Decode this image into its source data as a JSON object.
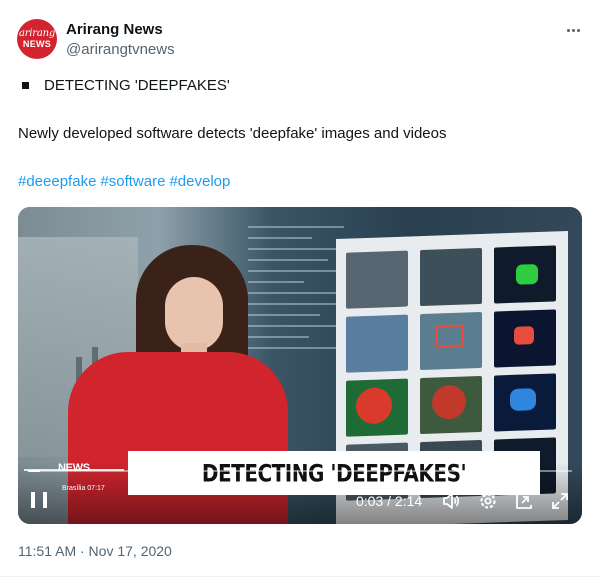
{
  "author": {
    "avatar_line1": "arirang",
    "avatar_line2": "NEWS",
    "name": "Arirang News",
    "handle": "@arirangtvnews"
  },
  "post": {
    "headline": "DETECTING 'DEEPFAKES'",
    "body": "Newly developed software detects 'deepfake' images and videos",
    "hashtags": [
      "#deeepfake",
      "#software",
      "#develop"
    ],
    "timestamp": "11:51 AM · Nov 17, 2020"
  },
  "video": {
    "caption": "DETECTING 'DEEPFAKES'",
    "channel_logo": "NEWS",
    "channel_sub": "Brasília 07:17",
    "current_time": "0:03",
    "duration": "2:14",
    "time_display": "0:03 / 2:14",
    "progress": 0.022
  },
  "icons": {
    "more": "more-icon",
    "bullet": "square-bullet-icon",
    "pause": "pause-icon",
    "volume": "volume-icon",
    "settings": "gear-icon",
    "pip": "pip-icon",
    "fullscreen": "fullscreen-icon"
  },
  "colors": {
    "link": "#1d9bf0",
    "secondary_text": "#536471",
    "avatar_bg": "#d3232f"
  }
}
